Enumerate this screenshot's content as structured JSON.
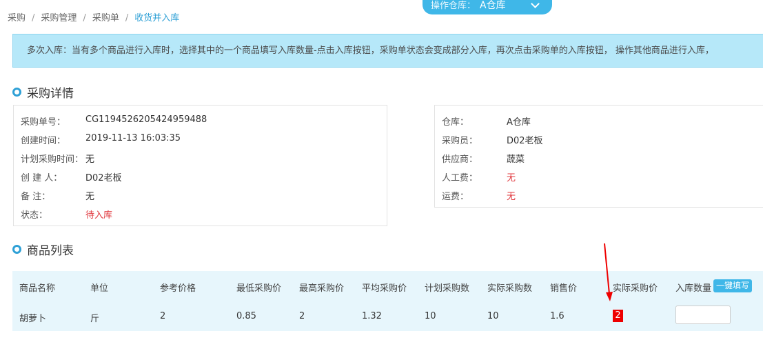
{
  "breadcrumb": {
    "items": [
      "采购",
      "采购管理",
      "采购单"
    ],
    "current": "收货并入库"
  },
  "warehouse_selector": {
    "label": "操作仓库：",
    "value": "A仓库",
    "icon": "chevron-down-icon"
  },
  "notice": {
    "text": "多次入库：当有多个商品进行入库时，选择其中的一个商品填写入库数量-点击入库按钮，采购单状态会变成部分入库，再次点击采购单的入库按钮， 操作其他商品进行入库，"
  },
  "purchase_detail": {
    "title": "采购详情",
    "left": [
      {
        "label": "采购单号：",
        "value": "CG1194526205424959488"
      },
      {
        "label": "创建时间：",
        "value": "2019-11-13 16:03:35"
      },
      {
        "label": "计划采购时间：",
        "value": "无"
      },
      {
        "label": "创 建 人：",
        "value": "D02老板"
      },
      {
        "label": "备 注：",
        "value": "无"
      },
      {
        "label": "状态：",
        "value": "待入库"
      }
    ],
    "right": [
      {
        "label": "仓库：",
        "value": "A仓库"
      },
      {
        "label": "采购员：",
        "value": "D02老板"
      },
      {
        "label": "供应商：",
        "value": "蔬菜"
      },
      {
        "label": "人工费：",
        "value": "无"
      },
      {
        "label": "运费：",
        "value": "无"
      }
    ]
  },
  "goods_list": {
    "title": "商品列表",
    "headers": [
      "商品名称",
      "单位",
      "参考价格",
      "最低采购价",
      "最高采购价",
      "平均采购价",
      "计划采购数",
      "实际采购数",
      "销售价",
      "实际采购价",
      "入库数量"
    ],
    "fill_button": "一键填写",
    "rows": [
      {
        "name": "胡萝卜",
        "unit": "斤",
        "ref_price": "2",
        "min_price": "0.85",
        "max_price": "2",
        "avg_price": "1.32",
        "planned_qty": "10",
        "actual_qty": "10",
        "sale_price": "1.6",
        "actual_price": "2",
        "inbound_qty": ""
      }
    ]
  },
  "colors": {
    "accent": "#3fb7e8",
    "status_red": "#e0383e",
    "notice_bg": "#b6e8f9",
    "table_bg": "#e7f6fc",
    "annotation_red": "#ee0000"
  }
}
